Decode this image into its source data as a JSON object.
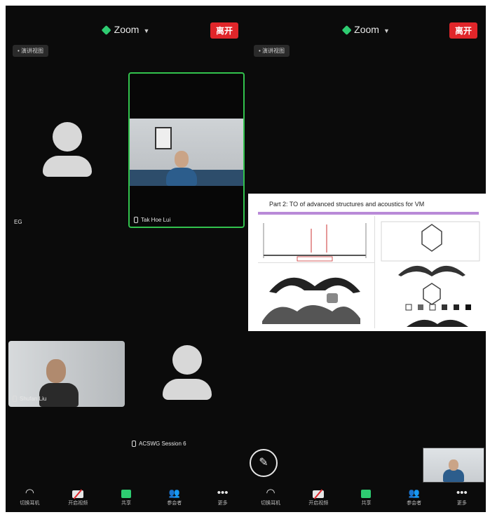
{
  "left": {
    "title": "Zoom",
    "leave_label": "离开",
    "speaker_chip": "• 演讲视图",
    "participants": {
      "blank": {
        "name": "EG"
      },
      "active": {
        "name": "Tak Hoe Lui"
      },
      "me": {
        "name": "Shufan Liu"
      },
      "other": {
        "name": "ACSWG Session 6"
      }
    },
    "toolbar": [
      {
        "label": "切换耳机",
        "icon": "headphones-icon"
      },
      {
        "label": "开启视频",
        "icon": "camera-off-icon"
      },
      {
        "label": "共享",
        "icon": "share-screen-icon"
      },
      {
        "label": "参会者",
        "icon": "participants-icon"
      },
      {
        "label": "更多",
        "icon": "more-icon"
      }
    ]
  },
  "right": {
    "title": "Zoom",
    "leave_label": "离开",
    "speaker_chip": "• 演讲视图",
    "slide": {
      "title": "Part 2: TO of advanced structures and acoustics for VM"
    },
    "toolbar": [
      {
        "label": "切换耳机",
        "icon": "headphones-icon"
      },
      {
        "label": "开启视频",
        "icon": "camera-off-icon"
      },
      {
        "label": "共享",
        "icon": "share-screen-icon"
      },
      {
        "label": "参会者",
        "icon": "participants-icon"
      },
      {
        "label": "更多",
        "icon": "more-icon"
      }
    ]
  },
  "colors": {
    "leave": "#e0262a",
    "active_border": "#32c24d",
    "encrypted": "#2ecc71"
  }
}
